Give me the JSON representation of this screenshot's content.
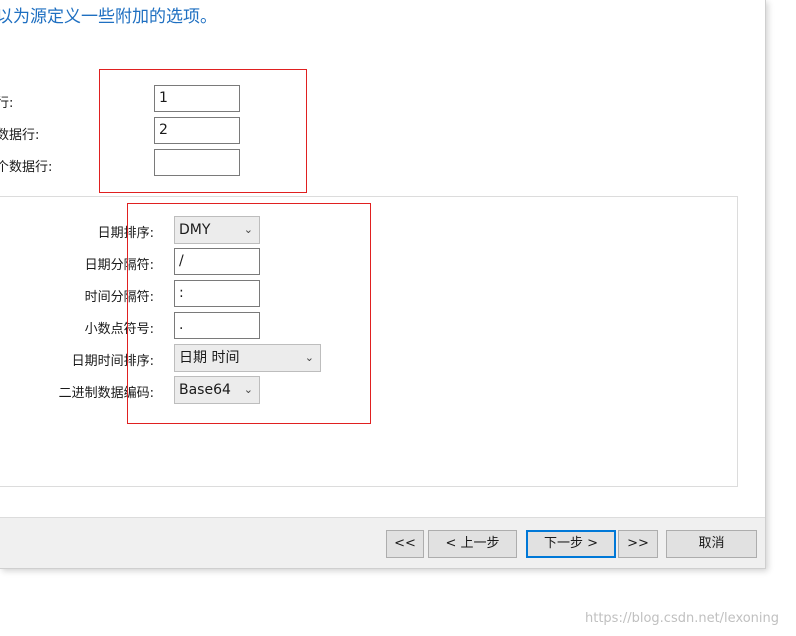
{
  "header": {
    "instruction": "以为源定义一些附加的选项。"
  },
  "row_options": [
    {
      "label": "行:",
      "value": "1"
    },
    {
      "label": "数据行:",
      "value": "2"
    },
    {
      "label": "个数据行:",
      "value": ""
    }
  ],
  "format_options": {
    "date_order": {
      "label": "日期排序:",
      "value": "DMY"
    },
    "date_separator": {
      "label": "日期分隔符:",
      "value": "/"
    },
    "time_separator": {
      "label": "时间分隔符:",
      "value": ":"
    },
    "decimal_symbol": {
      "label": "小数点符号:",
      "value": "."
    },
    "datetime_order": {
      "label": "日期时间排序:",
      "value": "日期 时间"
    },
    "binary_encoding": {
      "label": "二进制数据编码:",
      "value": "Base64"
    }
  },
  "footer": {
    "first_label": "<<",
    "back_label": "< 上一步",
    "next_label": "下一步 >",
    "last_label": ">>",
    "cancel_label": "取消"
  },
  "watermark": "https://blog.csdn.net/lexoning",
  "colors": {
    "heading": "#1e6fc1",
    "highlight_box": "#e02020",
    "primary_button_border": "#0078d7"
  },
  "icons": {
    "dropdown": "chevron-down-icon"
  }
}
